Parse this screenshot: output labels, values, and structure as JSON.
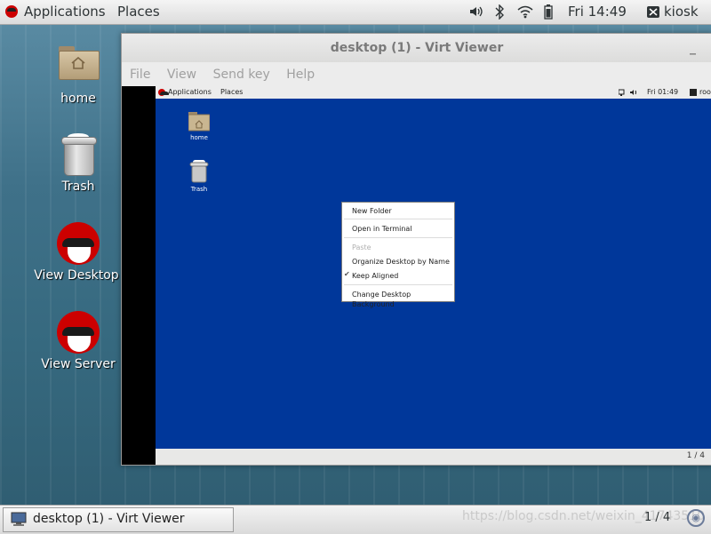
{
  "top_panel": {
    "applications": "Applications",
    "places": "Places",
    "time": "Fri 14:49",
    "user": "kiosk"
  },
  "host_icons": [
    {
      "label": "home",
      "icon": "home-folder-icon"
    },
    {
      "label": "Trash",
      "icon": "trash-icon"
    },
    {
      "label": "View Desktop",
      "icon": "redhat-icon"
    },
    {
      "label": "View Server",
      "icon": "redhat-icon"
    }
  ],
  "window": {
    "title": "desktop (1) - Virt Viewer",
    "menu": [
      "File",
      "View",
      "Send key",
      "Help"
    ]
  },
  "guest": {
    "applications": "Applications",
    "places": "Places",
    "time": "Fri 01:49",
    "user": "roo",
    "icons": [
      {
        "label": "home"
      },
      {
        "label": "Trash"
      }
    ],
    "context_menu": {
      "new_folder": "New Folder",
      "open_terminal": "Open in Terminal",
      "paste": "Paste",
      "organize": "Organize Desktop by Name",
      "keep_aligned": "Keep Aligned",
      "change_bg": "Change Desktop Background"
    },
    "page": "1 / 4"
  },
  "taskbar": {
    "task_label": "desktop (1) - Virt Viewer",
    "watermark": "https://blog.csdn.net/weixin_41743510",
    "workspace": "1 / 4"
  },
  "colors": {
    "guest_background": "#00379a",
    "brand_red": "#cc0000"
  }
}
